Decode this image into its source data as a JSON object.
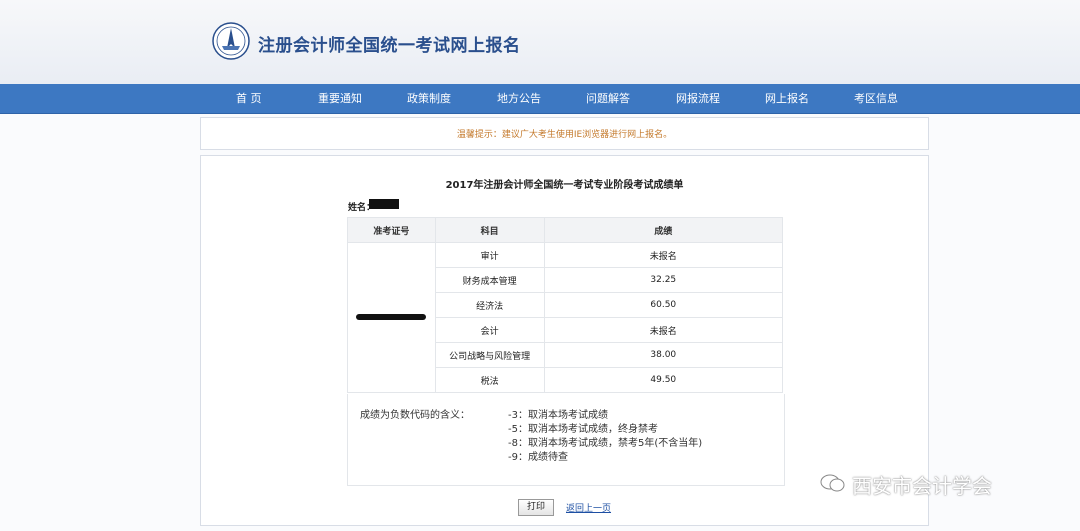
{
  "header": {
    "site_title": "注册会计师全国统一考试网上报名",
    "colors": {
      "nav_bg": "#3d78c2",
      "title": "#2a4f8d",
      "notice": "#c47a2c"
    }
  },
  "nav": {
    "items": [
      "首 页",
      "重要通知",
      "政策制度",
      "地方公告",
      "问题解答",
      "网报流程",
      "网上报名",
      "考区信息"
    ]
  },
  "notice": {
    "text": "温馨提示：建议广大考生使用IE浏览器进行网上报名。"
  },
  "report": {
    "title": "2017年注册会计师全国统一考试专业阶段考试成绩单",
    "name_label": "姓名：",
    "headers": {
      "id": "准考证号",
      "subject": "科目",
      "score": "成绩"
    },
    "rows": [
      {
        "subject": "审计",
        "score": "未报名"
      },
      {
        "subject": "财务成本管理",
        "score": "32.25"
      },
      {
        "subject": "经济法",
        "score": "60.50"
      },
      {
        "subject": "会计",
        "score": "未报名"
      },
      {
        "subject": "公司战略与风险管理",
        "score": "38.00"
      },
      {
        "subject": "税法",
        "score": "49.50"
      }
    ]
  },
  "codes": {
    "label": "成绩为负数代码的含义：",
    "items": [
      "-3：取消本场考试成绩",
      "-5：取消本场考试成绩，终身禁考",
      "-8：取消本场考试成绩，禁考5年(不含当年)",
      "-9：成绩待查"
    ]
  },
  "actions": {
    "print_label": "打印",
    "back_label": "返回上一页"
  },
  "watermark": {
    "text": "西安市会计学会",
    "icon": "wechat-icon"
  }
}
